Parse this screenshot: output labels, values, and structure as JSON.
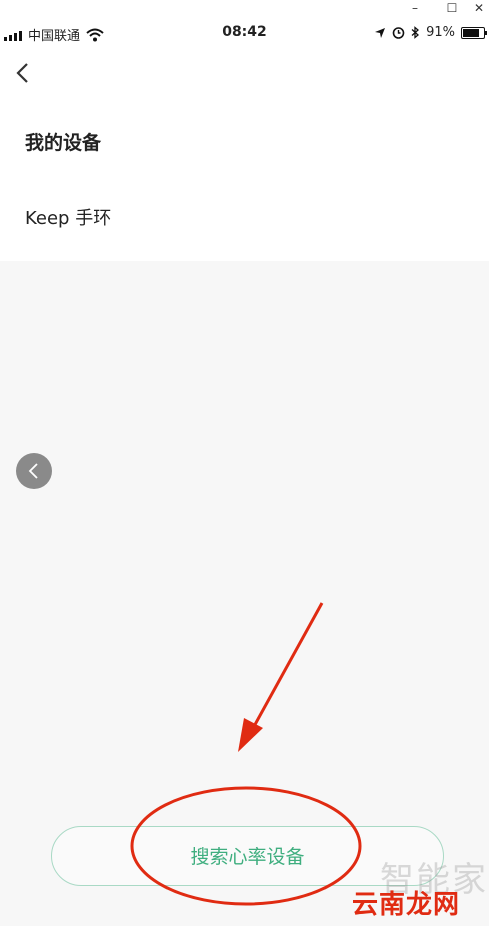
{
  "window_controls": {
    "minimize": "–",
    "maximize": "☐",
    "close": "✕"
  },
  "status_bar": {
    "carrier": "中国联通",
    "time": "08:42",
    "battery_percent": "91%",
    "battery_level": 0.91
  },
  "page": {
    "title": "我的设备",
    "device_name": "Keep 手环"
  },
  "actions": {
    "search_button": "搜索心率设备"
  },
  "watermark": {
    "brand_cn": "智能家",
    "site_name": "云南龙网"
  },
  "colors": {
    "accent_green": "#3fae7f",
    "button_border": "#a9d9c5",
    "annotation_red": "#e02b12"
  }
}
